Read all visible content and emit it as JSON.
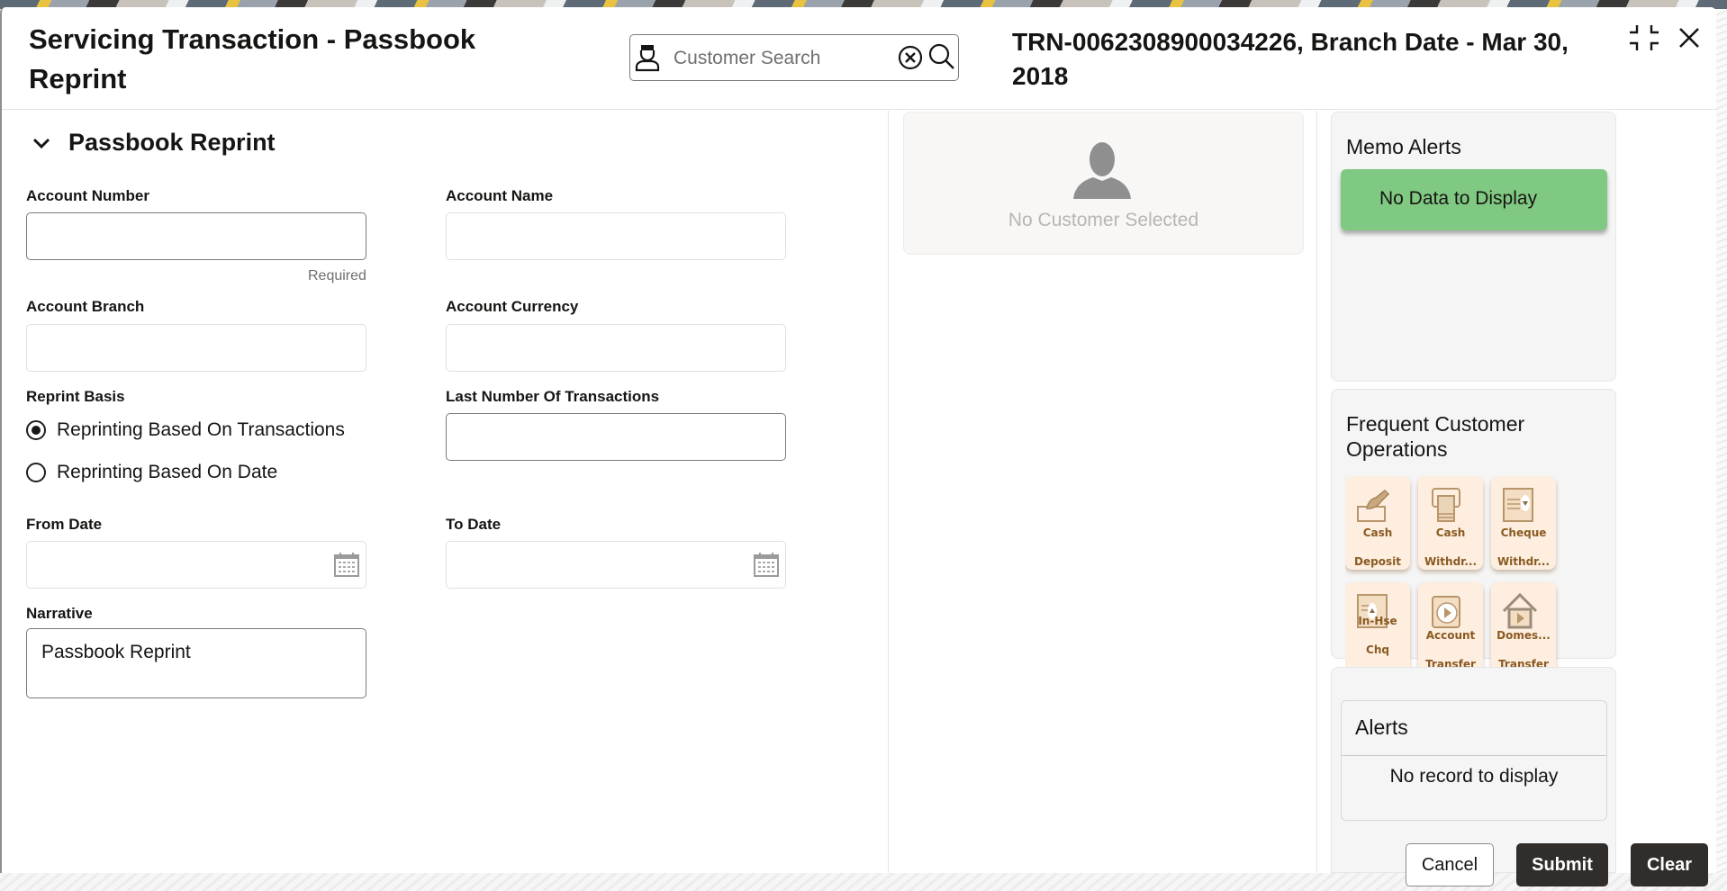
{
  "header": {
    "title": "Servicing Transaction - Passbook Reprint",
    "search_placeholder": "Customer Search",
    "transaction_info": "TRN-0062308900034226, Branch Date - Mar 30, 2018"
  },
  "section": {
    "title": "Passbook Reprint"
  },
  "form": {
    "account_number": {
      "label": "Account Number",
      "value": "",
      "hint": "Required"
    },
    "account_name": {
      "label": "Account Name",
      "value": ""
    },
    "account_branch": {
      "label": "Account Branch",
      "value": ""
    },
    "account_currency": {
      "label": "Account Currency",
      "value": ""
    },
    "reprint_basis": {
      "label": "Reprint Basis",
      "options": [
        {
          "label": "Reprinting Based On Transactions",
          "checked": true
        },
        {
          "label": "Reprinting Based On Date",
          "checked": false
        }
      ]
    },
    "last_number_of_transactions": {
      "label": "Last Number Of Transactions",
      "value": ""
    },
    "from_date": {
      "label": "From Date",
      "value": ""
    },
    "to_date": {
      "label": "To Date",
      "value": ""
    },
    "narrative": {
      "label": "Narrative",
      "value": "Passbook Reprint"
    }
  },
  "customer_card": {
    "message": "No Customer Selected"
  },
  "memo_alerts": {
    "title": "Memo Alerts",
    "message": "No Data to Display",
    "color": "#80c982"
  },
  "frequent_operations": {
    "title": "Frequent Customer Operations",
    "tiles": [
      {
        "line1": "Cash",
        "line2": "Deposit",
        "icon": "cash-deposit-icon"
      },
      {
        "line1": "Cash",
        "line2": "Withdr...",
        "icon": "cash-withdrawal-icon"
      },
      {
        "line1": "Cheque",
        "line2": "Withdr...",
        "icon": "cheque-withdrawal-icon"
      },
      {
        "line1": "In-Hse",
        "line2": "Chq",
        "icon": "in-house-cheque-icon"
      },
      {
        "line1": "Account",
        "line2": "Transfer",
        "icon": "account-transfer-icon"
      },
      {
        "line1": "Domes...",
        "line2": "Transfer",
        "icon": "domestic-transfer-icon"
      }
    ]
  },
  "alerts": {
    "title": "Alerts",
    "message": "No record to display"
  },
  "footer": {
    "cancel_label": "Cancel",
    "submit_label": "Submit",
    "clear_label": "Clear"
  }
}
